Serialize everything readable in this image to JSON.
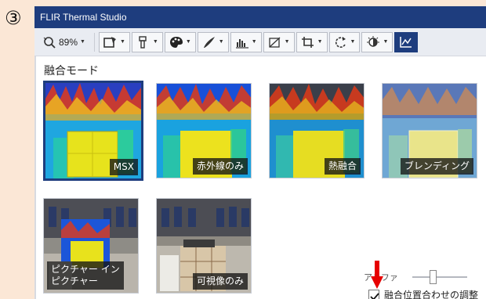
{
  "step_marker": "③",
  "window": {
    "title": "FLIR Thermal Studio"
  },
  "toolbar": {
    "zoom_label": "89%",
    "buttons": [
      {
        "name": "zoom-button",
        "icon": "zoom-icon"
      },
      {
        "name": "image-mode-button",
        "icon": "image-mode-icon"
      },
      {
        "name": "measure-tool-button",
        "icon": "measure-tool-icon"
      },
      {
        "name": "palette-button",
        "icon": "palette-icon"
      },
      {
        "name": "annotation-button",
        "icon": "pen-icon"
      },
      {
        "name": "scale-button",
        "icon": "histogram-icon"
      },
      {
        "name": "transform-button",
        "icon": "transform-icon"
      },
      {
        "name": "crop-button",
        "icon": "crop-icon"
      },
      {
        "name": "rotate-button",
        "icon": "rotate-icon"
      },
      {
        "name": "fusion-button",
        "icon": "fusion-icon"
      },
      {
        "name": "chart-button",
        "icon": "chart-icon"
      }
    ]
  },
  "fusion_panel": {
    "title": "融合モード",
    "modes": [
      {
        "label": "MSX",
        "selected": true
      },
      {
        "label": "赤外線のみ",
        "selected": false
      },
      {
        "label": "熱融合",
        "selected": false
      },
      {
        "label": "ブレンディング",
        "selected": false
      },
      {
        "label": "ピクチャー イン ピクチャー",
        "selected": false
      },
      {
        "label": "可視像のみ",
        "selected": false
      }
    ],
    "alpha_label": "アルファ",
    "alignment_checkbox_label": "融合位置合わせの調整"
  },
  "colors": {
    "titlebar": "#1e3d7e",
    "selection": "#1e3d7e",
    "annotation_arrow": "#e60000",
    "background": "#fbe7d6"
  }
}
